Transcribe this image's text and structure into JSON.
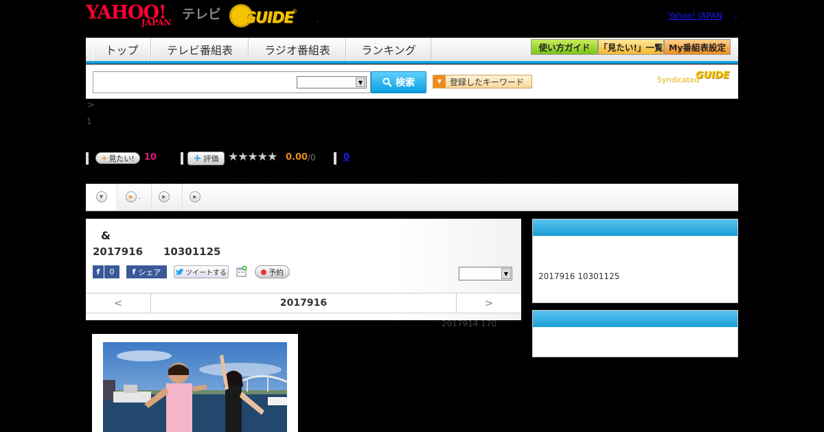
{
  "header": {
    "yahoo_logo": "YAHOO!",
    "yahoo_sub": "JAPAN",
    "tv_label": "テレビ",
    "gguide_logo": "GUIDE",
    "gguide_reg": "®",
    "dot": ",",
    "yahoo_japan_link": "Yahoo! JAPAN",
    "yahoo_japan_link_dot": ","
  },
  "nav": {
    "tabs": [
      {
        "label": "トップ"
      },
      {
        "label": "テレビ番組表"
      },
      {
        "label": "ラジオ番組表"
      },
      {
        "label": "ランキング"
      }
    ],
    "guide_label": "使い方ガイド",
    "mitai_list_label": "「見たい!」一覧",
    "my_schedule_label": "My番組表設定"
  },
  "search": {
    "input_value": "",
    "select_value": "",
    "button_label": "検索",
    "keyword_label": "登録したキーワード",
    "syndicated_label": "Syndicated",
    "syndicated_logo": "GUIDE"
  },
  "breadcrumb": ">",
  "page_number": "1",
  "ratings": {
    "mitai_label": "見たい!",
    "mitai_count": "10",
    "hyoka_label": "評価",
    "stars": "★★★★★",
    "score": "0.00",
    "score_total": "/0",
    "review_count": "0"
  },
  "tabs": [
    {
      "label": ""
    },
    {
      "label": "."
    },
    {
      "label": ""
    },
    {
      "label": ""
    }
  ],
  "program": {
    "title": "&",
    "date": "2017916",
    "time": "10301125",
    "fb_like_count": "0",
    "fb_share_label": "シェア",
    "tweet_label": "ツイートする",
    "reserve_label": "予約",
    "select_value": ""
  },
  "date_nav": {
    "prev": "<",
    "current": "2017916",
    "next": ">"
  },
  "update_note": "2017914  170",
  "sidebar": {
    "box1_text": "2017916  10301125"
  },
  "colors": {
    "accent_blue": "#1aa0dc",
    "pink_count": "#e0197d",
    "score_orange": "#e98b1c",
    "brand_red": "#ff0033",
    "gguide_yellow": "#f5c400"
  }
}
